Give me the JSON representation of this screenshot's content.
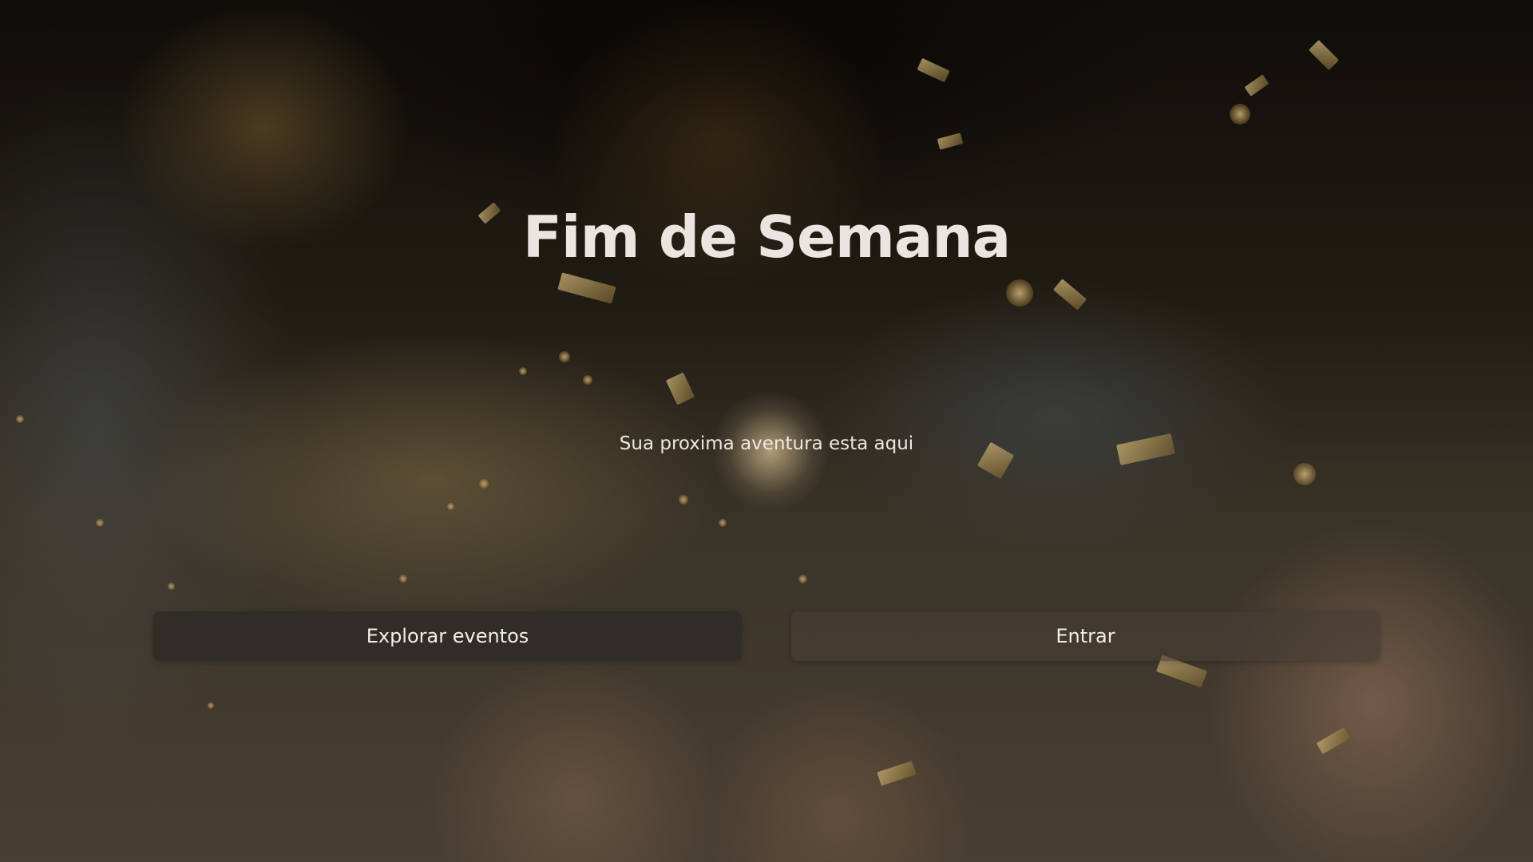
{
  "hero": {
    "title": "Fim de Semana",
    "subtitle": "Sua proxima aventura esta aqui"
  },
  "actions": {
    "explore_label": "Explorar eventos",
    "login_label": "Entrar"
  }
}
